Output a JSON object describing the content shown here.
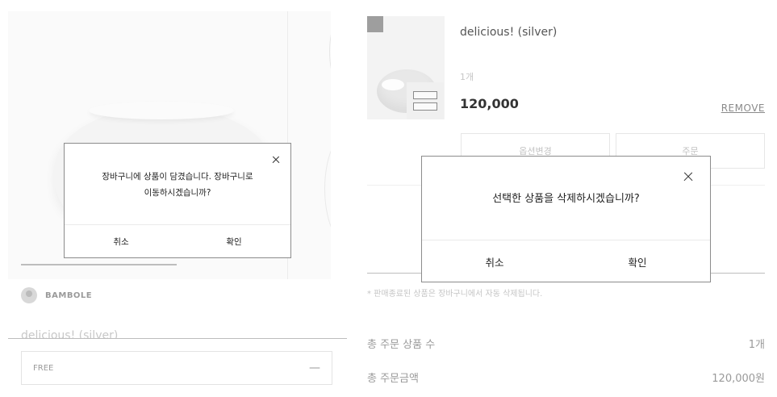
{
  "left_product": {
    "brand": "BAMBOLE",
    "title": "delicious! (silver)",
    "option": {
      "label": "FREE",
      "minus_icon": "—"
    }
  },
  "cart_item": {
    "name": "delicious! (silver)",
    "quantity": "1개",
    "price": "120,000",
    "remove_label": "REMOVE",
    "change_option_label": "옵션변경",
    "order_label": "주문",
    "checked": true
  },
  "notice": "* 판매종료된 상품은 장바구니에서 자동 삭제됩니다.",
  "summary": {
    "count_label": "총 주문 상품 수",
    "count_value": "1개",
    "amount_label": "총 주문금액",
    "amount_value": "120,000원"
  },
  "cart_dialog": {
    "message_line1": "장바구니에 상품이 담겼습니다. 장바구니로",
    "message_line2": "이동하시겠습니까?",
    "cancel_label": "취소",
    "confirm_label": "확인"
  },
  "delete_dialog": {
    "message": "선택한 상품을 삭제하시겠습니까?",
    "cancel_label": "취소",
    "confirm_label": "확인"
  }
}
